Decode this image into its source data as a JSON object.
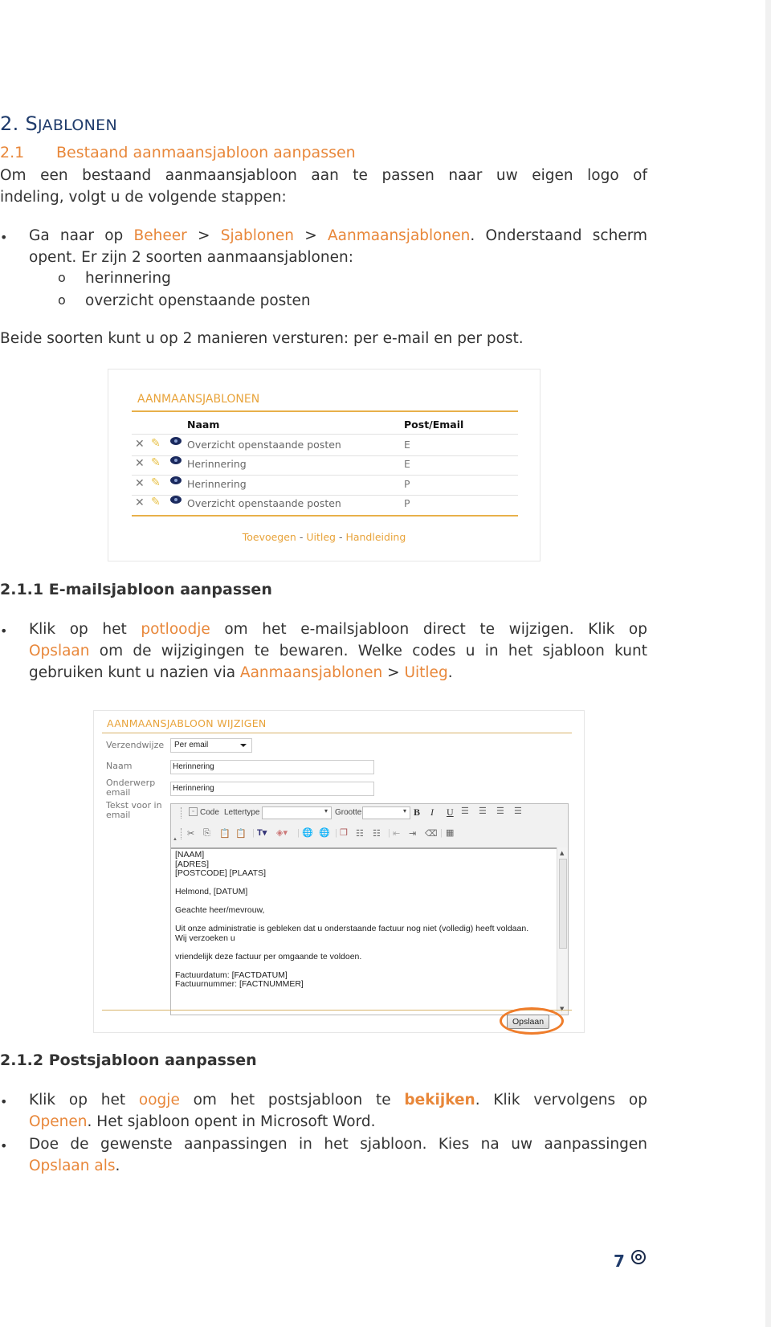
{
  "section": {
    "number": "2.",
    "title_first": "S",
    "title_rest": "JABLONEN"
  },
  "subsection": {
    "number": "2.1",
    "title": "Bestaand aanmaansjabloon aanpassen"
  },
  "intro": {
    "line1": "Om een bestaand aanmaansjabloon aan te passen naar uw eigen logo of",
    "line2": "indeling, volgt u de volgende stappen:"
  },
  "step1": {
    "prefix": "Ga naar op ",
    "link1": "Beheer",
    "sep1": " > ",
    "link2": "Sjablonen",
    "sep2": " > ",
    "link3": "Aanmaansjablonen",
    "suffix": ". Onderstaand scherm",
    "line2": "opent. Er zijn 2 soorten aanmaansjablonen:",
    "subitems": [
      "herinnering",
      "overzicht openstaande posten"
    ]
  },
  "note": "Beide soorten kunt u op 2 manieren versturen: per e-mail en per post.",
  "screen1": {
    "title": "AANMAANSJABLONEN",
    "col_name": "Naam",
    "col_type": "Post/Email",
    "rows": [
      {
        "name": "Overzicht openstaande posten",
        "type": "E"
      },
      {
        "name": "Herinnering",
        "type": "E"
      },
      {
        "name": "Herinnering",
        "type": "P"
      },
      {
        "name": "Overzicht openstaande posten",
        "type": "P"
      }
    ],
    "links": {
      "add": "Toevoegen",
      "sep": "-",
      "explain": "Uitleg",
      "manual": "Handleiding"
    }
  },
  "email_section": {
    "heading": "2.1.1  E-mailsjabloon aanpassen",
    "l1_a": "Klik op het ",
    "l1_link": "potloodje",
    "l1_b": " om het e-mailsjabloon direct te wijzigen. Klik op",
    "l2_link": "Opslaan",
    "l2_b": " om de wijzigingen te bewaren. Welke codes u in het sjabloon kunt",
    "l3_a": "gebruiken kunt u nazien via ",
    "l3_link1": "Aanmaansjablonen",
    "l3_sep": " > ",
    "l3_link2": "Uitleg",
    "l3_end": "."
  },
  "screen2": {
    "title": "AANMAANSJABLOON WIJZIGEN",
    "label_method": "Verzendwijze",
    "method_value": "Per email",
    "label_name": "Naam",
    "name_value": "Herinnering",
    "label_subject_1": "Onderwerp",
    "label_subject_2": "email",
    "subject_value": "Herinnering",
    "label_text_1": "Tekst voor in",
    "label_text_2": "email",
    "toolbar": {
      "code": "Code",
      "font": "Lettertype",
      "size": "Grootte",
      "bold": "B",
      "italic": "I",
      "underline": "U"
    },
    "body": "[NAAM]\n[ADRES]\n[POSTCODE] [PLAATS]\n\nHelmond, [DATUM]\n\nGeachte heer/mevrouw,\n\nUit onze administratie is gebleken dat u onderstaande factuur nog niet (volledig) heeft voldaan.\nWij verzoeken u\n\nvriendelijk deze factuur per omgaande te voldoen.\n\nFactuurdatum: [FACTDATUM]\nFactuurnummer: [FACTNUMMER]",
    "save_label": "Opslaan"
  },
  "post_section": {
    "heading": "2.1.2  Postsjabloon aanpassen",
    "b1_a": "Klik op het ",
    "b1_link": "oogje",
    "b1_b": " om het postsjabloon te ",
    "b1_bold": "bekijken",
    "b1_c": ". Klik vervolgens op",
    "b1_l2_link": "Openen",
    "b1_l2_b": ". Het sjabloon opent in Microsoft Word.",
    "b2_a": "Doe de gewenste aanpassingen in het sjabloon. Kies na uw aanpassingen",
    "b2_link": "Opslaan als",
    "b2_end": "."
  },
  "footer": {
    "page": "7"
  },
  "colors": {
    "accent": "#e8873a",
    "heading": "#1f3b6b",
    "gold": "#e8b04a",
    "highlight_ring": "#ef7d2b"
  }
}
